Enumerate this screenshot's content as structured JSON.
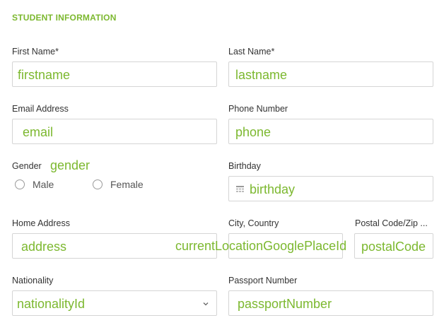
{
  "section": {
    "title": "STUDENT INFORMATION"
  },
  "first_name": {
    "label": "First Name*",
    "value": "firstname"
  },
  "last_name": {
    "label": "Last Name*",
    "value": "lastname"
  },
  "email": {
    "label": "Email Address",
    "value": "email"
  },
  "phone": {
    "label": "Phone Number",
    "value": "phone"
  },
  "gender": {
    "label": "Gender",
    "value": "gender",
    "options": [
      "Male",
      "Female"
    ]
  },
  "birthday": {
    "label": "Birthday",
    "value": "birthday",
    "icon": "calendar-icon"
  },
  "home_address": {
    "label": "Home Address",
    "value": "address"
  },
  "city_country": {
    "label": "City, Country",
    "value": "currentLocationGooglePlaceId"
  },
  "postal_code": {
    "label": "Postal Code/Zip ...",
    "value": "postalCode"
  },
  "nationality": {
    "label": "Nationality",
    "value": "nationalityId",
    "icon": "chevron-down-icon"
  },
  "passport": {
    "label": "Passport Number",
    "value": "passportNumber"
  },
  "colors": {
    "accent": "#7cb82f",
    "label": "#333333",
    "border": "#d5d5d5"
  }
}
